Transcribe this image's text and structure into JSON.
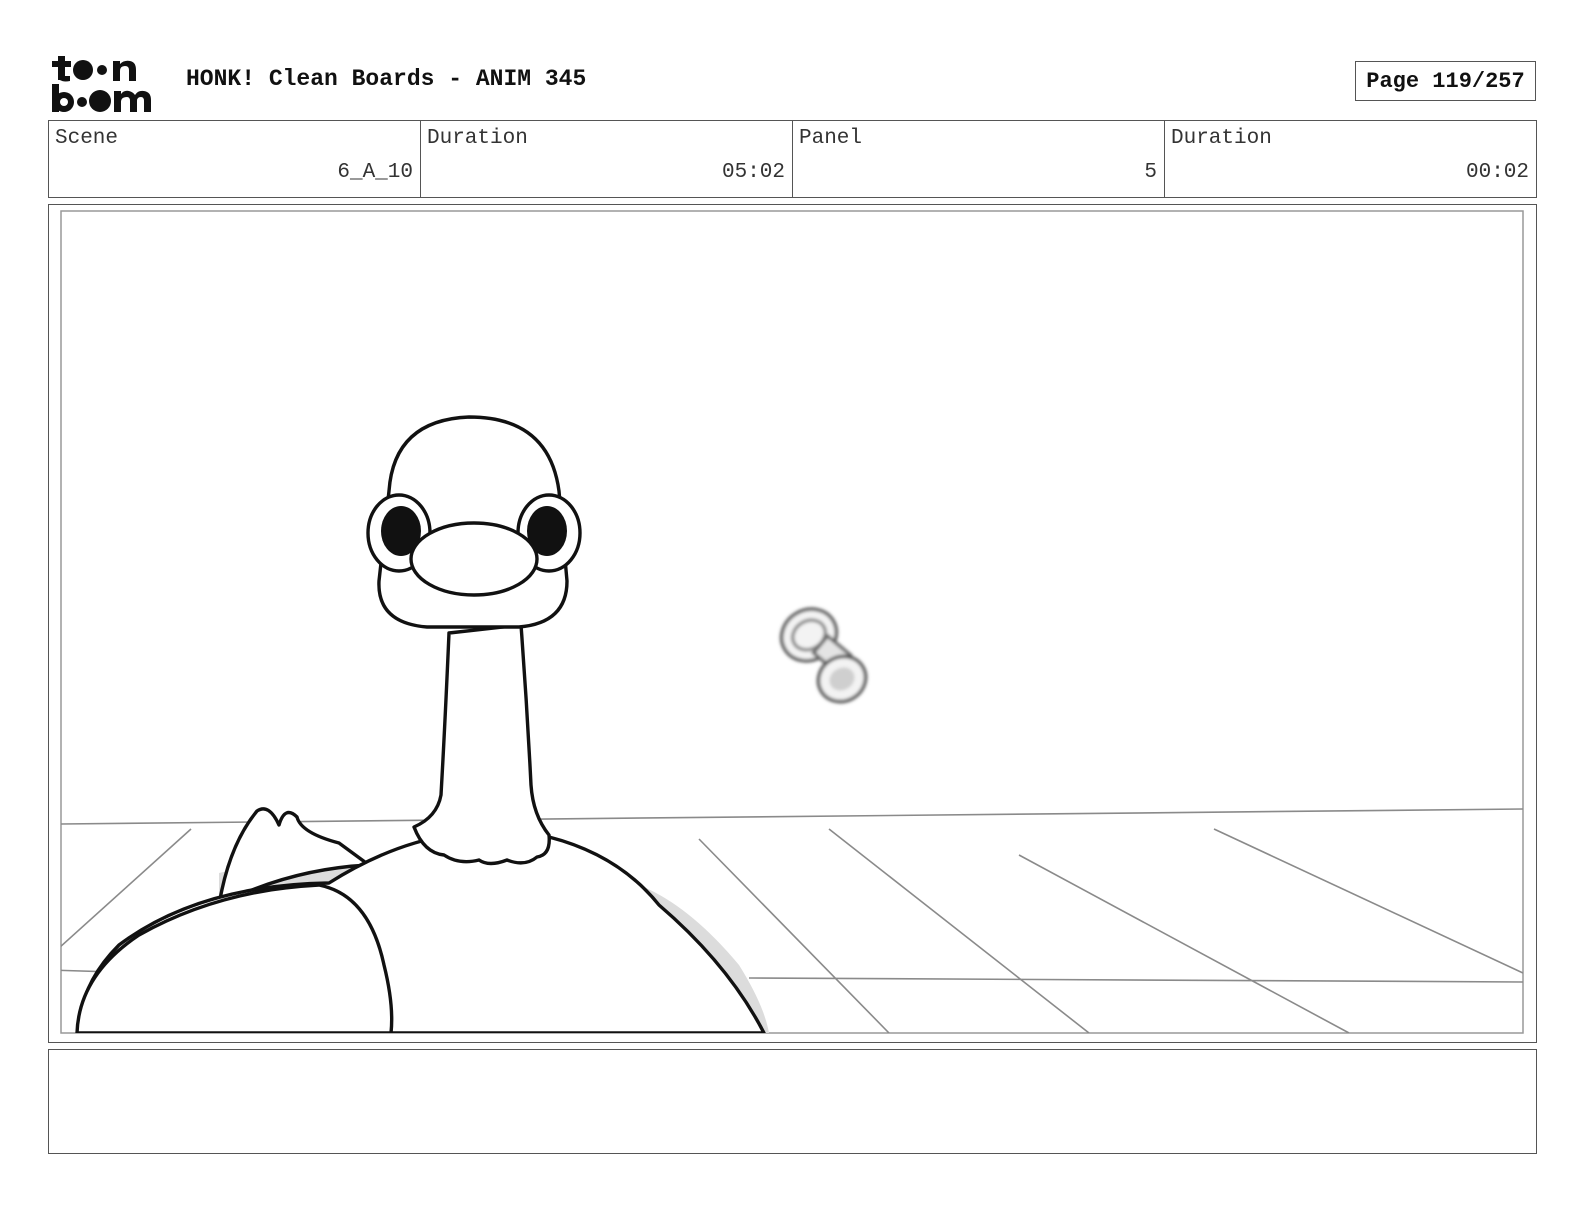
{
  "header": {
    "logo_text": "toon boom",
    "title": "HONK! Clean Boards - ANIM 345",
    "page": "Page 119/257"
  },
  "info": {
    "scene_label": "Scene",
    "scene_value": "6_A_10",
    "scene_duration_label": "Duration",
    "scene_duration_value": "05:02",
    "panel_label": "Panel",
    "panel_value": "5",
    "panel_duration_label": "Duration",
    "panel_duration_value": "00:02"
  },
  "notes": {
    "text": ""
  }
}
